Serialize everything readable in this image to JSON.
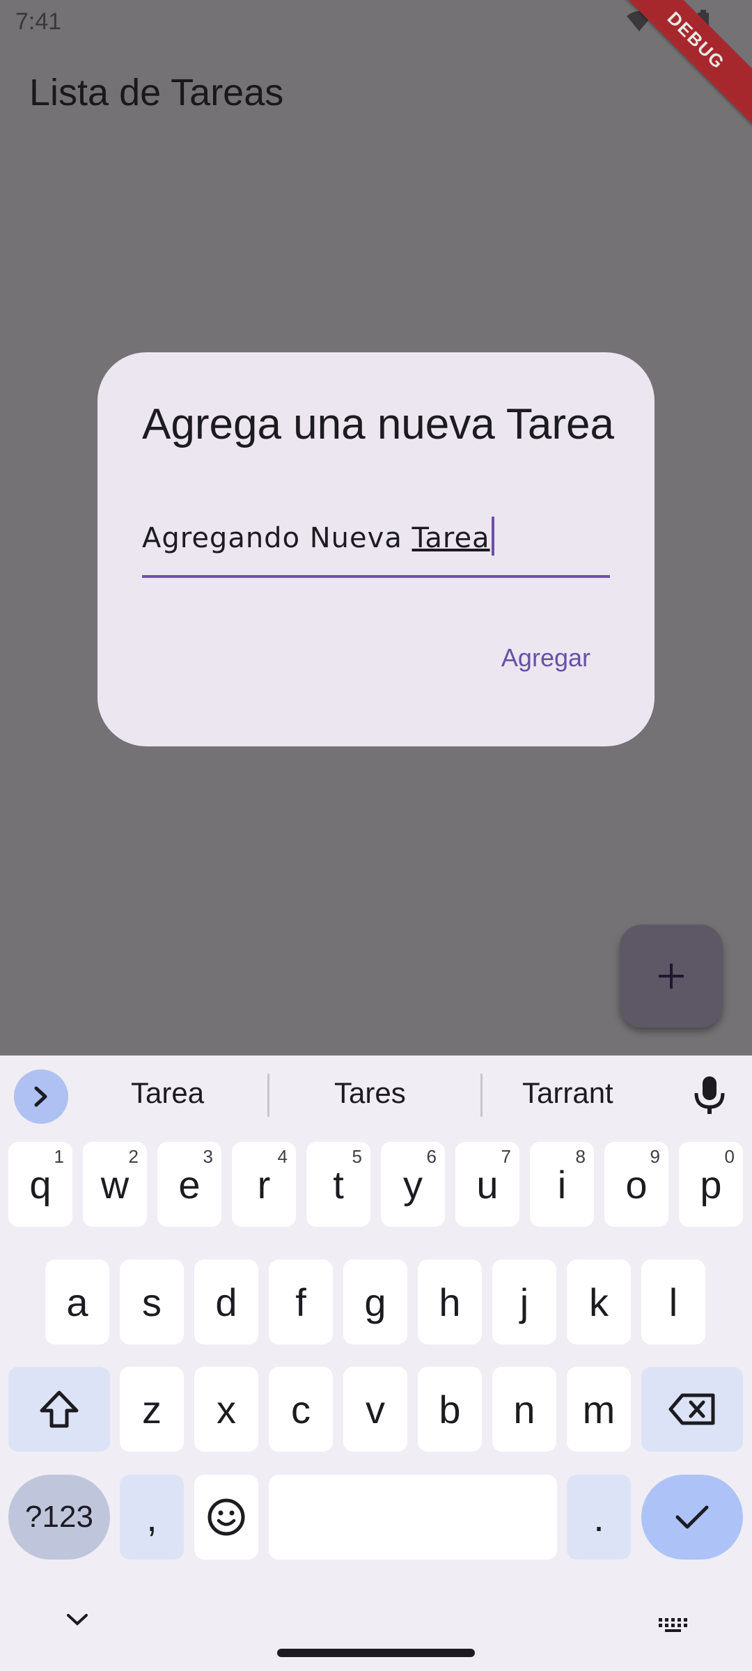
{
  "status_bar": {
    "time": "7:41"
  },
  "debug_banner": "DEBUG",
  "app": {
    "title": "Lista de Tareas"
  },
  "fab": {
    "icon": "plus-icon"
  },
  "dialog": {
    "title": "Agrega una nueva Tarea",
    "input_value_prefix": "Agregando Nueva ",
    "input_value_composing": "Tarea",
    "action_label": "Agregar",
    "accent_color": "#6750a4"
  },
  "keyboard": {
    "suggestions": [
      "Tarea",
      "Tares",
      "Tarrant"
    ],
    "row1": [
      {
        "k": "q",
        "s": "1"
      },
      {
        "k": "w",
        "s": "2"
      },
      {
        "k": "e",
        "s": "3"
      },
      {
        "k": "r",
        "s": "4"
      },
      {
        "k": "t",
        "s": "5"
      },
      {
        "k": "y",
        "s": "6"
      },
      {
        "k": "u",
        "s": "7"
      },
      {
        "k": "i",
        "s": "8"
      },
      {
        "k": "o",
        "s": "9"
      },
      {
        "k": "p",
        "s": "0"
      }
    ],
    "row2": [
      "a",
      "s",
      "d",
      "f",
      "g",
      "h",
      "j",
      "k",
      "l"
    ],
    "row3": [
      "z",
      "x",
      "c",
      "v",
      "b",
      "n",
      "m"
    ],
    "symbols_label": "?123",
    "comma": ",",
    "period": "."
  }
}
